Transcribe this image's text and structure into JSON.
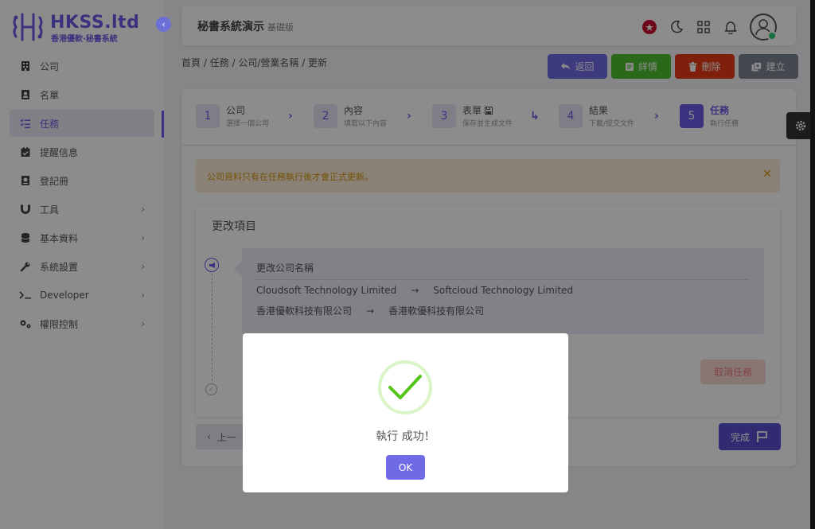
{
  "brand": {
    "name": "HKSS.ltd",
    "tagline": "香港優軟·秘書系統"
  },
  "sidebar": {
    "items": [
      {
        "label": "公司",
        "icon": "building-icon",
        "active": false,
        "has_children": false
      },
      {
        "label": "名單",
        "icon": "contact-card-icon",
        "active": false,
        "has_children": false
      },
      {
        "label": "任務",
        "icon": "checklist-icon",
        "active": true,
        "has_children": false
      },
      {
        "label": "提醒信息",
        "icon": "calendar-check-icon",
        "active": false,
        "has_children": false
      },
      {
        "label": "登記冊",
        "icon": "register-book-icon",
        "active": false,
        "has_children": false
      },
      {
        "label": "工具",
        "icon": "magnet-icon",
        "active": false,
        "has_children": true
      },
      {
        "label": "基本資料",
        "icon": "database-icon",
        "active": false,
        "has_children": true
      },
      {
        "label": "系統設置",
        "icon": "wrench-icon",
        "active": false,
        "has_children": true
      },
      {
        "label": "Developer",
        "icon": "terminal-icon",
        "active": false,
        "has_children": true
      },
      {
        "label": "權限控制",
        "icon": "gears-icon",
        "active": false,
        "has_children": true
      }
    ]
  },
  "header": {
    "title": "秘書系統演示",
    "subtitle": "基礎版"
  },
  "breadcrumb": "首頁 / 任務 / 公司/營業名稱 / 更新",
  "actions": [
    {
      "label": "返回",
      "color": "#6f6ae6",
      "icon": "back-arrow-icon"
    },
    {
      "label": "詳情",
      "color": "#4cbf2f",
      "icon": "detail-doc-icon"
    },
    {
      "label": "刪除",
      "color": "#e53b16",
      "icon": "trash-icon"
    },
    {
      "label": "建立",
      "color": "#7a8591",
      "icon": "copy-add-icon"
    }
  ],
  "steps": [
    {
      "num": "1",
      "title": "公司",
      "desc": "選擇一個公司"
    },
    {
      "num": "2",
      "title": "內容",
      "desc": "填寫以下內容"
    },
    {
      "num": "3",
      "title": "表單",
      "desc": "保存並生成文件"
    },
    {
      "num": "4",
      "title": "結果",
      "desc": "下載/提交文件"
    },
    {
      "num": "5",
      "title": "任務",
      "desc": "執行任務"
    }
  ],
  "alert": {
    "text": "公司資料只有在任務執行後才會正式更新。"
  },
  "changes": {
    "title": "更改項目",
    "heading": "更改公司名稱",
    "rows": [
      {
        "from": "Cloudsoft Technology Limited",
        "to": "Softcloud Technology Limited"
      },
      {
        "from": "香港優軟科技有限公司",
        "to": "香港軟優科技有限公司"
      }
    ],
    "cancel_label": "取消任務"
  },
  "nav": {
    "prev_label": "上一",
    "finish_label": "完成"
  },
  "modal": {
    "message": "執行 成功！",
    "ok_label": "OK"
  },
  "colors": {
    "accent": "#6c5ce7",
    "success": "#52c41a"
  }
}
